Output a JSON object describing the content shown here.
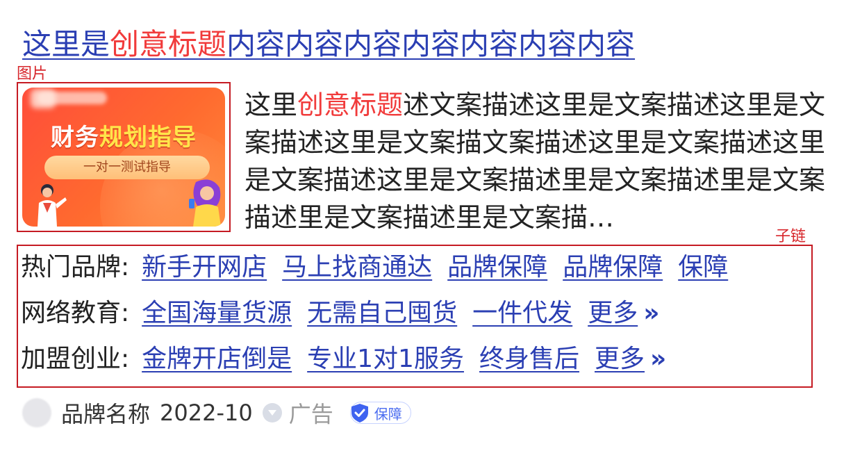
{
  "title": {
    "pre": "这里是",
    "highlight": "创意标题",
    "post": "内容内容内容内容内容内容内容"
  },
  "annotations": {
    "image_label": "图片",
    "sublinks_label": "子链"
  },
  "image": {
    "headline_white": "财务",
    "headline_yellow": "规划指导",
    "pill_text": "一对一测试指导"
  },
  "description": {
    "pre": "这里",
    "highlight": "创意标题",
    "post": "述文案描述这里是文案描述这里是文案描述这里是文案描文案描述这里是文案描述这里是文案描述这里是文案描述里是文案描述里是文案描述里是文案描述里是文案描…"
  },
  "sublinks": [
    {
      "label": "热门品牌:",
      "links": [
        "新手开网店",
        "马上找商通达",
        "品牌保障",
        "品牌保障",
        "保障"
      ],
      "more": ""
    },
    {
      "label": "网络教育:",
      "links": [
        "全国海量货源",
        "无需自己囤货",
        "一件代发"
      ],
      "more": "更多"
    },
    {
      "label": "加盟创业:",
      "links": [
        "金牌开店倒是",
        "专业1对1服务",
        "终身售后"
      ],
      "more": "更多"
    }
  ],
  "more_chevron": "»",
  "footer": {
    "brand": "品牌名称",
    "date": "2022-10",
    "ad": "广告",
    "badge": "保障"
  },
  "colors": {
    "link": "#2b3fb3",
    "highlight": "#f13b3b",
    "annotation": "#d7262b",
    "text": "#222222"
  },
  "icons": [
    "chevron-down-circle-icon",
    "shield-check-icon",
    "double-chevron-right-icon"
  ]
}
